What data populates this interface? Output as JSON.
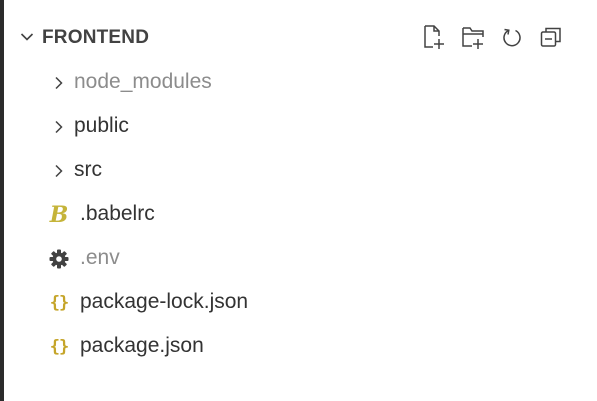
{
  "explorer": {
    "section": {
      "title": "FRONTEND",
      "actions": [
        {
          "icon": "new-file-icon"
        },
        {
          "icon": "new-folder-icon"
        },
        {
          "icon": "refresh-icon"
        },
        {
          "icon": "collapse-all-icon"
        }
      ]
    },
    "items": [
      {
        "type": "folder",
        "label": "node_modules",
        "dimmed": true,
        "icon": "chevron-right-icon"
      },
      {
        "type": "folder",
        "label": "public",
        "dimmed": false,
        "icon": "chevron-right-icon"
      },
      {
        "type": "folder",
        "label": "src",
        "dimmed": false,
        "icon": "chevron-right-icon"
      },
      {
        "type": "file",
        "label": ".babelrc",
        "dimmed": false,
        "icon": "babel-icon",
        "icon_color": "#c5b43a"
      },
      {
        "type": "file",
        "label": ".env",
        "dimmed": true,
        "icon": "gear-icon",
        "icon_color": "#424242"
      },
      {
        "type": "file",
        "label": "package-lock.json",
        "dimmed": false,
        "icon": "json-icon",
        "icon_color": "#c5a52a"
      },
      {
        "type": "file",
        "label": "package.json",
        "dimmed": false,
        "icon": "json-icon",
        "icon_color": "#c5a52a"
      }
    ]
  }
}
